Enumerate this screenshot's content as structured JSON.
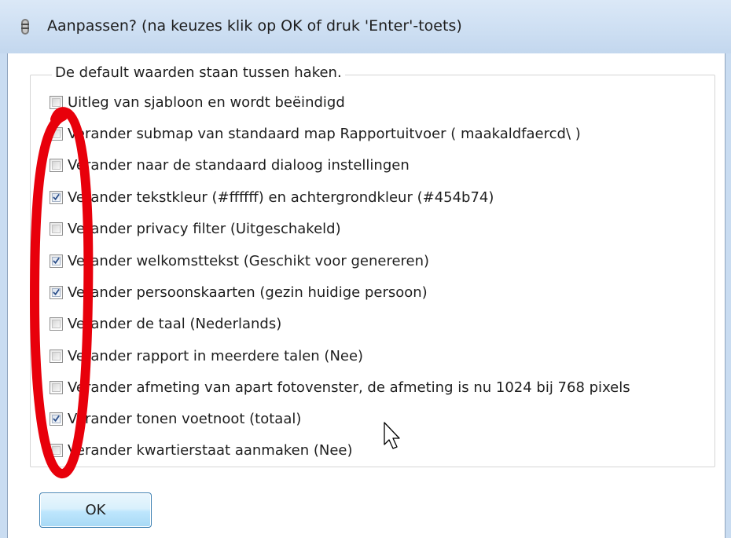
{
  "window": {
    "title": "Aanpassen?  (na keuzes klik op OK of druk 'Enter'-toets)",
    "icon": "settings-app-icon"
  },
  "group": {
    "label": "De default waarden staan tussen haken."
  },
  "options": [
    {
      "label": "Uitleg van sjabloon en wordt beëindigd",
      "checked": false
    },
    {
      "label": "Verander submap van standaard map Rapportuitvoer ( maakaldfaercd\\ )",
      "checked": false
    },
    {
      "label": "Verander naar de standaard dialoog instellingen",
      "checked": false
    },
    {
      "label": "Verander tekstkleur (#ffffff) en achtergrondkleur (#454b74)",
      "checked": true
    },
    {
      "label": "Verander privacy filter (Uitgeschakeld)",
      "checked": false
    },
    {
      "label": "Verander welkomsttekst (Geschikt voor genereren)",
      "checked": true
    },
    {
      "label": "Verander persoonskaarten (gezin huidige persoon)",
      "checked": true
    },
    {
      "label": "Verander de taal (Nederlands)",
      "checked": false
    },
    {
      "label": "Verander rapport in meerdere talen (Nee)",
      "checked": false
    },
    {
      "label": "Verander afmeting van apart fotovenster, de afmeting is nu 1024 bij 768 pixels",
      "checked": false
    },
    {
      "label": "Verander tonen voetnoot (totaal)",
      "checked": true
    },
    {
      "label": "Verander kwartierstaat aanmaken (Nee)",
      "checked": false
    }
  ],
  "buttons": {
    "ok_label": "OK"
  },
  "colors": {
    "title_bar": "#cfe0f3",
    "annotation": "#e8000b",
    "checkmark": "#2c4f8a"
  },
  "overlay": {
    "annotation": "red-ellipse-around-checkboxes",
    "cursor": "mouse-pointer-icon"
  }
}
